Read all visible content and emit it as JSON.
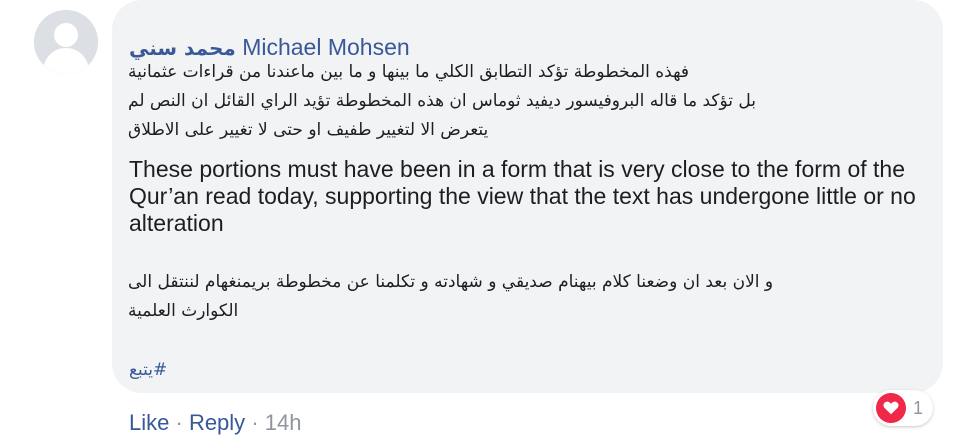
{
  "comment": {
    "author": {
      "name_arabic": "محمد سني",
      "name_latin": "Michael Mohsen"
    },
    "paragraph_1_lines": [
      "فهذه المخطوطة تؤكد التطابق الكلي ما بينها و ما بين ماعندنا من قراءات عثمانية",
      "بل تؤكد ما قاله البروفيسور ديفيد ثوماس ان هذه المخطوطة تؤيد الراي القائل ان النص لم",
      "يتعرض الا لتغيير طفيف او حتى لا تغيير على الاطلاق"
    ],
    "quote_english": "These portions must have been in a form that is very close to the form of the Qur’an read today, supporting the view that the text has undergone little or no alteration",
    "paragraph_2_lines": [
      "و الان بعد ان وضعنا كلام بيهنام صديقي و شهادته و تكلمنا عن مخطوطة بريمنغهام لننتقل الى",
      "الكوارث العلمية"
    ],
    "hashtag": "#يتبع"
  },
  "actions": {
    "like_label": "Like",
    "separator": "·",
    "reply_label": "Reply",
    "timestamp": "14h"
  },
  "reactions": {
    "icon": "heart-icon",
    "count": "1",
    "color": "#f0284a"
  },
  "colors": {
    "link": "#385898",
    "text": "#1c1e21",
    "muted": "#90949c",
    "bubble": "#f2f3f5"
  }
}
